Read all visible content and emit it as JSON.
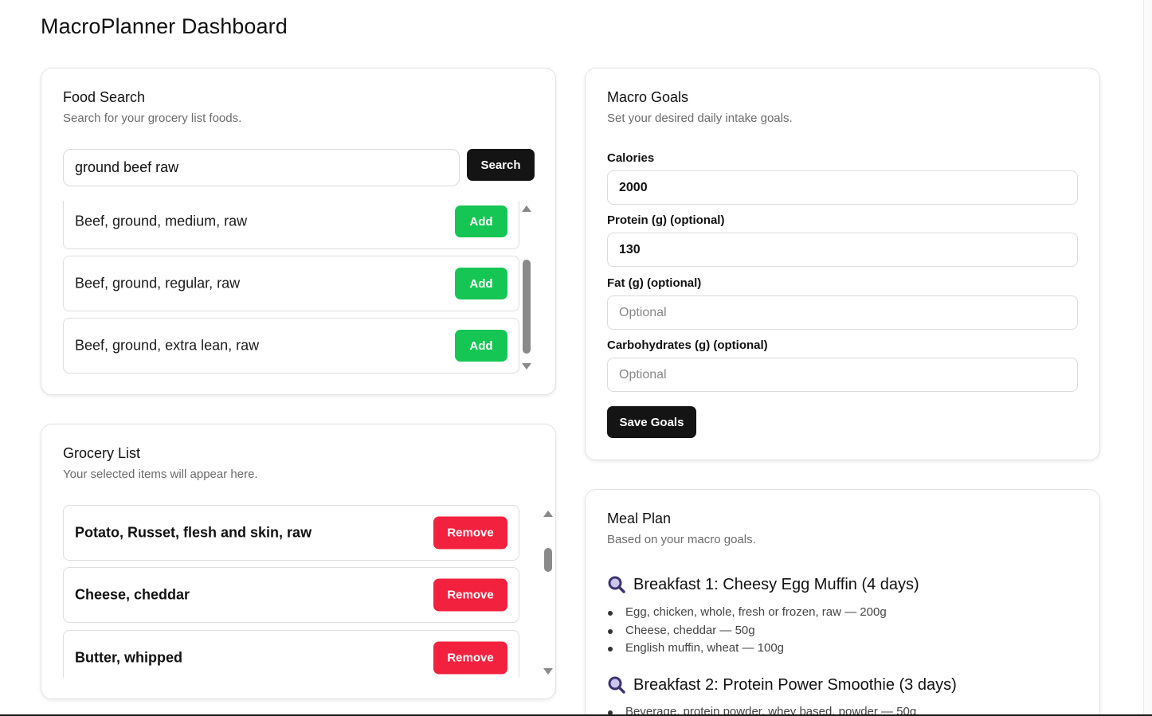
{
  "page": {
    "title": "MacroPlanner Dashboard"
  },
  "food_search": {
    "title": "Food Search",
    "subtitle": "Search for your grocery list foods.",
    "query": "ground beef raw",
    "search_label": "Search",
    "results": [
      {
        "name": "Beef, ground, medium, raw",
        "action": "Add"
      },
      {
        "name": "Beef, ground, regular, raw",
        "action": "Add"
      },
      {
        "name": "Beef, ground, extra lean, raw",
        "action": "Add"
      }
    ]
  },
  "grocery": {
    "title": "Grocery List",
    "subtitle": "Your selected items will appear here.",
    "items": [
      {
        "name": "Potato, Russet, flesh and skin, raw",
        "action": "Remove"
      },
      {
        "name": "Cheese, cheddar",
        "action": "Remove"
      },
      {
        "name": "Butter, whipped",
        "action": "Remove"
      }
    ]
  },
  "goals": {
    "title": "Macro Goals",
    "subtitle": "Set your desired daily intake goals.",
    "fields": [
      {
        "label": "Calories",
        "value": "2000",
        "placeholder": ""
      },
      {
        "label": "Protein (g) (optional)",
        "value": "130",
        "placeholder": "Optional"
      },
      {
        "label": "Fat (g) (optional)",
        "value": "",
        "placeholder": "Optional"
      },
      {
        "label": "Carbohydrates (g) (optional)",
        "value": "",
        "placeholder": "Optional"
      }
    ],
    "save_label": "Save Goals"
  },
  "meal_plan": {
    "title": "Meal Plan",
    "subtitle": "Based on your macro goals.",
    "icon": "magnifier-icon",
    "meals": [
      {
        "title": "Breakfast 1: Cheesy Egg Muffin (4 days)",
        "items": [
          "Egg, chicken, whole, fresh or frozen, raw — 200g",
          "Cheese, cheddar — 50g",
          "English muffin, wheat — 100g"
        ]
      },
      {
        "title": "Breakfast 2: Protein Power Smoothie (3 days)",
        "items": [
          "Beverage, protein powder, whey based, powder — 50g"
        ]
      }
    ]
  },
  "colors": {
    "add": "#16c654",
    "remove": "#f2213d",
    "dark_button": "#141414"
  }
}
